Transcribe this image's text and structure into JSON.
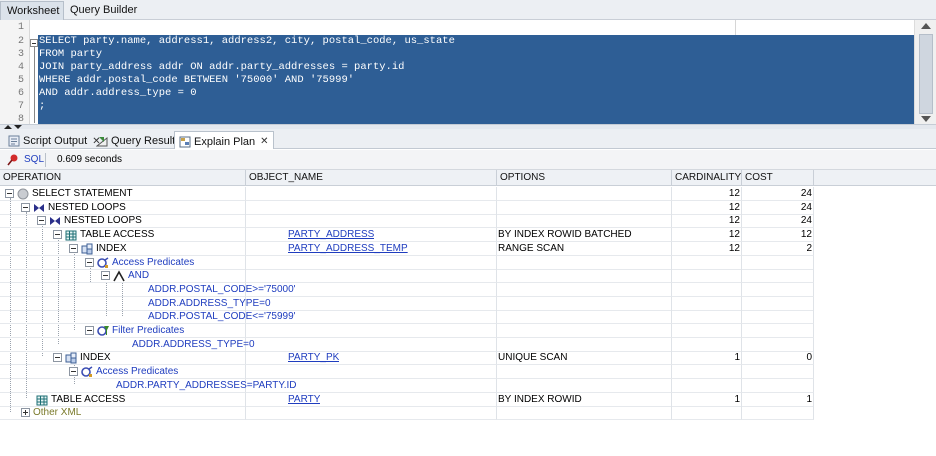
{
  "tabs": {
    "worksheet": "Worksheet",
    "query_builder": "Query Builder"
  },
  "editor": {
    "line_numbers": [
      "1",
      "2",
      "3",
      "4",
      "5",
      "6",
      "7",
      "8"
    ],
    "lines": [
      "",
      "SELECT party.name, address1, address2, city, postal_code, us_state",
      "FROM party",
      "JOIN party_address addr ON addr.party_addresses = party.id",
      "WHERE addr.postal_code BETWEEN '75000' AND '75999'",
      "AND addr.address_type = 0",
      ";",
      ""
    ]
  },
  "output_tabs": {
    "script_output": "Script Output",
    "query_result": "Query Result",
    "explain_plan": "Explain Plan"
  },
  "toolbar": {
    "sql_label": "SQL",
    "timing": "0.609 seconds"
  },
  "plan": {
    "columns": {
      "operation": "OPERATION",
      "object_name": "OBJECT_NAME",
      "options": "OPTIONS",
      "cardinality": "CARDINALITY",
      "cost": "COST"
    },
    "rows": [
      {
        "operation": "SELECT STATEMENT",
        "object": "",
        "options": "",
        "cardinality": "12",
        "cost": "24"
      },
      {
        "operation": "NESTED LOOPS",
        "object": "",
        "options": "",
        "cardinality": "12",
        "cost": "24"
      },
      {
        "operation": "NESTED LOOPS",
        "object": "",
        "options": "",
        "cardinality": "12",
        "cost": "24"
      },
      {
        "operation": "TABLE ACCESS",
        "object": "PARTY_ADDRESS",
        "options": "BY INDEX ROWID BATCHED",
        "cardinality": "12",
        "cost": "12"
      },
      {
        "operation": "INDEX",
        "object": "PARTY_ADDRESS_TEMP",
        "options": "RANGE SCAN",
        "cardinality": "12",
        "cost": "2"
      },
      {
        "operation": "Access Predicates",
        "object": "",
        "options": "",
        "cardinality": "",
        "cost": ""
      },
      {
        "operation": "AND",
        "object": "",
        "options": "",
        "cardinality": "",
        "cost": ""
      },
      {
        "operation": "ADDR.POSTAL_CODE>='75000'",
        "object": "",
        "options": "",
        "cardinality": "",
        "cost": ""
      },
      {
        "operation": "ADDR.ADDRESS_TYPE=0",
        "object": "",
        "options": "",
        "cardinality": "",
        "cost": ""
      },
      {
        "operation": "ADDR.POSTAL_CODE<='75999'",
        "object": "",
        "options": "",
        "cardinality": "",
        "cost": ""
      },
      {
        "operation": "Filter Predicates",
        "object": "",
        "options": "",
        "cardinality": "",
        "cost": ""
      },
      {
        "operation": "ADDR.ADDRESS_TYPE=0",
        "object": "",
        "options": "",
        "cardinality": "",
        "cost": ""
      },
      {
        "operation": "INDEX",
        "object": "PARTY_PK",
        "options": "UNIQUE SCAN",
        "cardinality": "1",
        "cost": "0"
      },
      {
        "operation": "Access Predicates",
        "object": "",
        "options": "",
        "cardinality": "",
        "cost": ""
      },
      {
        "operation": "ADDR.PARTY_ADDRESSES=PARTY.ID",
        "object": "",
        "options": "",
        "cardinality": "",
        "cost": ""
      },
      {
        "operation": "TABLE ACCESS",
        "object": "PARTY",
        "options": "BY INDEX ROWID",
        "cardinality": "1",
        "cost": "1"
      },
      {
        "operation": "Other XML",
        "object": "",
        "options": "",
        "cardinality": "",
        "cost": ""
      }
    ]
  }
}
